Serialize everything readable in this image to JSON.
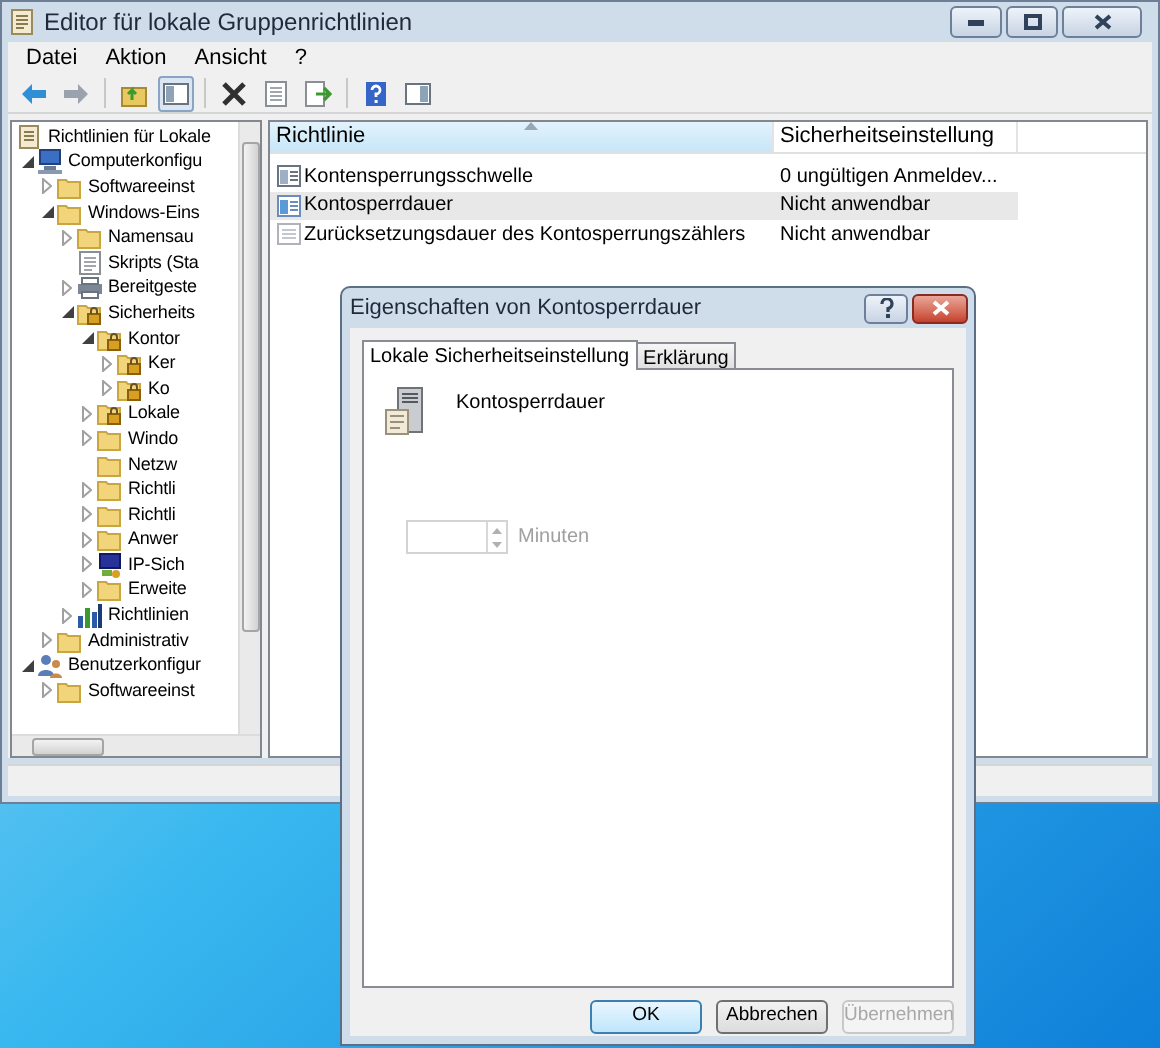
{
  "window": {
    "title": "Editor für lokale Gruppenrichtlinien"
  },
  "menu": [
    "Datei",
    "Aktion",
    "Ansicht",
    "?"
  ],
  "toolbar": [
    {
      "kind": "back",
      "pressed": false
    },
    {
      "kind": "forward",
      "pressed": false
    },
    {
      "kind": "sep"
    },
    {
      "kind": "up",
      "pressed": false
    },
    {
      "kind": "tree",
      "pressed": true
    },
    {
      "kind": "sep"
    },
    {
      "kind": "delete",
      "pressed": false
    },
    {
      "kind": "properties",
      "pressed": false
    },
    {
      "kind": "export",
      "pressed": false
    },
    {
      "kind": "sep"
    },
    {
      "kind": "help",
      "pressed": false
    },
    {
      "kind": "pane",
      "pressed": false
    }
  ],
  "tree": [
    {
      "label": "Richtlinien für Lokale",
      "kind": "doc",
      "children": [
        {
          "label": "Computerkonfigu",
          "kind": "computer",
          "expanded": true,
          "children": [
            {
              "label": "Softwareeinst",
              "kind": "folder",
              "expanded": false
            },
            {
              "label": "Windows-Eins",
              "kind": "folder",
              "expanded": true,
              "children": [
                {
                  "label": "Namensau",
                  "kind": "folder",
                  "expanded": false
                },
                {
                  "label": "Skripts (Sta",
                  "kind": "script"
                },
                {
                  "label": "Bereitgeste",
                  "kind": "printer",
                  "expanded": false
                },
                {
                  "label": "Sicherheits",
                  "kind": "lockfolder",
                  "expanded": true,
                  "children": [
                    {
                      "label": "Kontor",
                      "kind": "lockfolder",
                      "expanded": true,
                      "children": [
                        {
                          "label": "Ker",
                          "kind": "lockfolder",
                          "expanded": false
                        },
                        {
                          "label": "Ko",
                          "kind": "lockfolder",
                          "expanded": false
                        }
                      ]
                    },
                    {
                      "label": "Lokale",
                      "kind": "lockfolder",
                      "expanded": false
                    },
                    {
                      "label": "Windo",
                      "kind": "folder",
                      "expanded": false
                    },
                    {
                      "label": "Netzw",
                      "kind": "folder"
                    },
                    {
                      "label": "Richtli",
                      "kind": "folder",
                      "expanded": false
                    },
                    {
                      "label": "Richtli",
                      "kind": "folder",
                      "expanded": false
                    },
                    {
                      "label": "Anwer",
                      "kind": "folder",
                      "expanded": false
                    },
                    {
                      "label": "IP-Sich",
                      "kind": "network",
                      "expanded": false
                    },
                    {
                      "label": "Erweite",
                      "kind": "folder",
                      "expanded": false
                    }
                  ]
                },
                {
                  "label": "Richtlinien",
                  "kind": "chart",
                  "expanded": false
                }
              ]
            },
            {
              "label": "Administrativ",
              "kind": "folder",
              "expanded": false
            }
          ]
        },
        {
          "label": "Benutzerkonfigur",
          "kind": "user",
          "expanded": true,
          "children": [
            {
              "label": "Softwareeinst",
              "kind": "folder",
              "expanded": false
            }
          ]
        }
      ]
    }
  ],
  "list": {
    "columns": [
      {
        "label": "Richtlinie",
        "sorted": true
      },
      {
        "label": "Sicherheitseinstellung",
        "sorted": false
      }
    ],
    "rows": [
      {
        "kind": "policy",
        "policy": "Kontensperrungsschwelle",
        "setting": "0 ungültigen Anmeldev...",
        "selected": false
      },
      {
        "kind": "policy-edit",
        "policy": "Kontosperrdauer",
        "setting": "Nicht anwendbar",
        "selected": true
      },
      {
        "kind": "policy-off",
        "policy": "Zurücksetzungsdauer des Kontosperrungszählers",
        "setting": "Nicht anwendbar",
        "selected": false
      }
    ]
  },
  "dialog": {
    "title": "Eigenschaften von Kontosperrdauer",
    "tabs": [
      {
        "label": "Lokale Sicherheitseinstellung",
        "selected": true
      },
      {
        "label": "Erklärung",
        "selected": false
      }
    ],
    "policy_name": "Kontosperrdauer",
    "spinner": {
      "disabled": true,
      "unit": "Minuten"
    },
    "buttons": [
      {
        "label": "OK",
        "default": true,
        "disabled": false
      },
      {
        "label": "Abbrechen",
        "default": false,
        "disabled": false
      },
      {
        "label": "Übernehmen",
        "default": false,
        "disabled": true
      }
    ]
  }
}
